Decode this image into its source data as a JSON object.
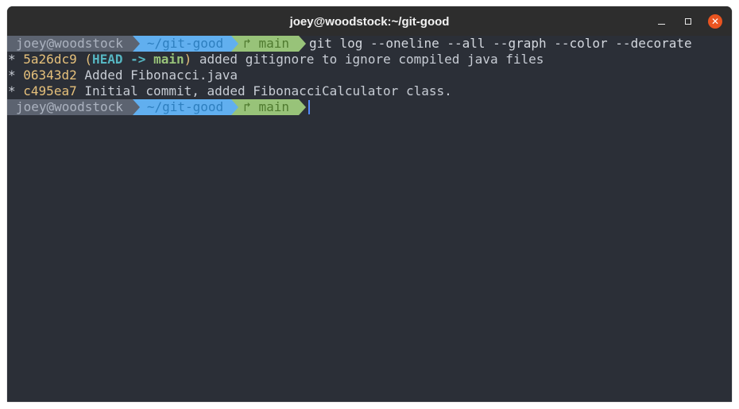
{
  "window": {
    "title": "joey@woodstock:~/git-good",
    "controls": {
      "minimize": "–",
      "maximize": "□",
      "close": "✕"
    },
    "close_color": "#e95420"
  },
  "prompt": {
    "user_host": "joey@woodstock",
    "dir": "~/git-good",
    "branch_icon": "branch-icon",
    "branch": "main",
    "colors": {
      "user_bg": "#5c6370",
      "dir_bg": "#61afef",
      "git_bg": "#98c379"
    }
  },
  "command": "git log --oneline --all --graph --color --decorate",
  "log": [
    {
      "graph": "*",
      "hash": "5a26dc9",
      "deco_open": "(",
      "head": "HEAD",
      "arrow": "->",
      "branch": "main",
      "deco_close": ")",
      "message": "added gitignore to ignore compiled java files"
    },
    {
      "graph": "*",
      "hash": "06343d2",
      "message": "Added Fibonacci.java"
    },
    {
      "graph": "*",
      "hash": "c495ea7",
      "message": "Initial commit, added FibonacciCalculator class."
    }
  ]
}
